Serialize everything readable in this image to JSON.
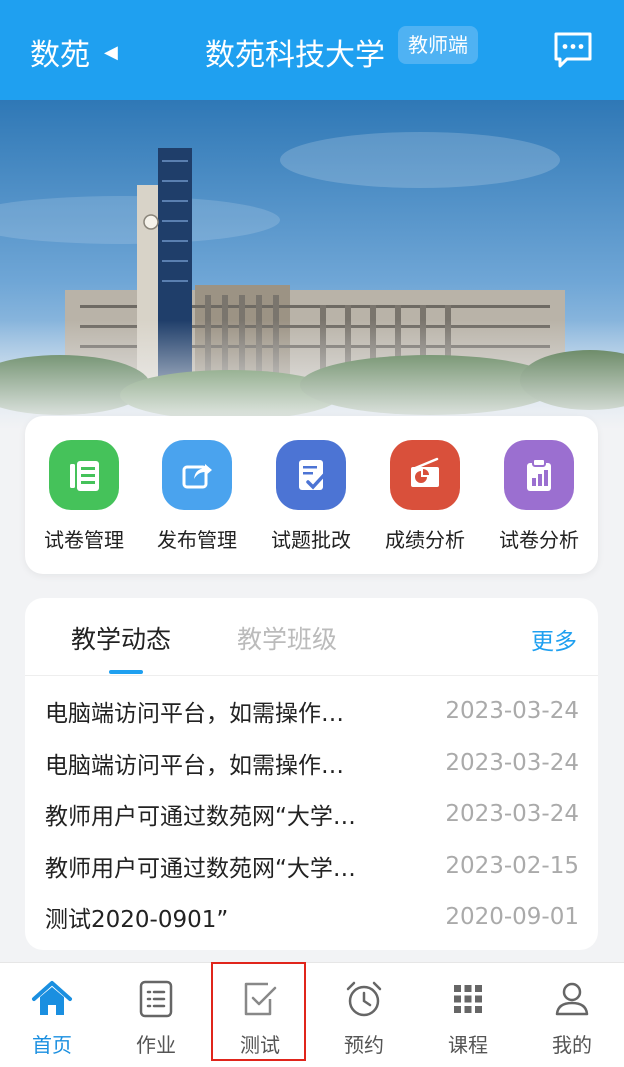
{
  "header": {
    "brand": "数苑",
    "title": "数苑科技大学",
    "badge": "教师端",
    "message_icon": "message-icon"
  },
  "quick_menu": [
    {
      "label": "试卷管理",
      "icon": "paper-manage-icon",
      "color": "#45c25a"
    },
    {
      "label": "发布管理",
      "icon": "publish-icon",
      "color": "#4aa3ee"
    },
    {
      "label": "试题批改",
      "icon": "grading-icon",
      "color": "#4c74d4"
    },
    {
      "label": "成绩分析",
      "icon": "score-analysis-icon",
      "color": "#d9503b"
    },
    {
      "label": "试卷分析",
      "icon": "paper-analysis-icon",
      "color": "#9b6fd0"
    }
  ],
  "news": {
    "tabs": [
      {
        "label": "教学动态",
        "active": true
      },
      {
        "label": "教学班级",
        "active": false
      }
    ],
    "more_label": "更多",
    "items": [
      {
        "title": "电脑端访问平台，如需操作…",
        "date": "2023-03-24"
      },
      {
        "title": "电脑端访问平台，如需操作…",
        "date": "2023-03-24"
      },
      {
        "title": "教师用户可通过数苑网“大学…",
        "date": "2023-03-24"
      },
      {
        "title": "教师用户可通过数苑网“大学…",
        "date": "2023-02-15"
      },
      {
        "title": "测试2020-0901”",
        "date": "2020-09-01"
      }
    ]
  },
  "bottom_nav": [
    {
      "label": "首页",
      "icon": "home-icon",
      "active": true
    },
    {
      "label": "作业",
      "icon": "homework-icon",
      "active": false
    },
    {
      "label": "测试",
      "icon": "test-icon",
      "active": false
    },
    {
      "label": "预约",
      "icon": "alarm-icon",
      "active": false
    },
    {
      "label": "课程",
      "icon": "grid-icon",
      "active": false
    },
    {
      "label": "我的",
      "icon": "user-icon",
      "active": false
    }
  ],
  "colors": {
    "accent": "#1fa0f0",
    "highlight": "#e0251b"
  }
}
